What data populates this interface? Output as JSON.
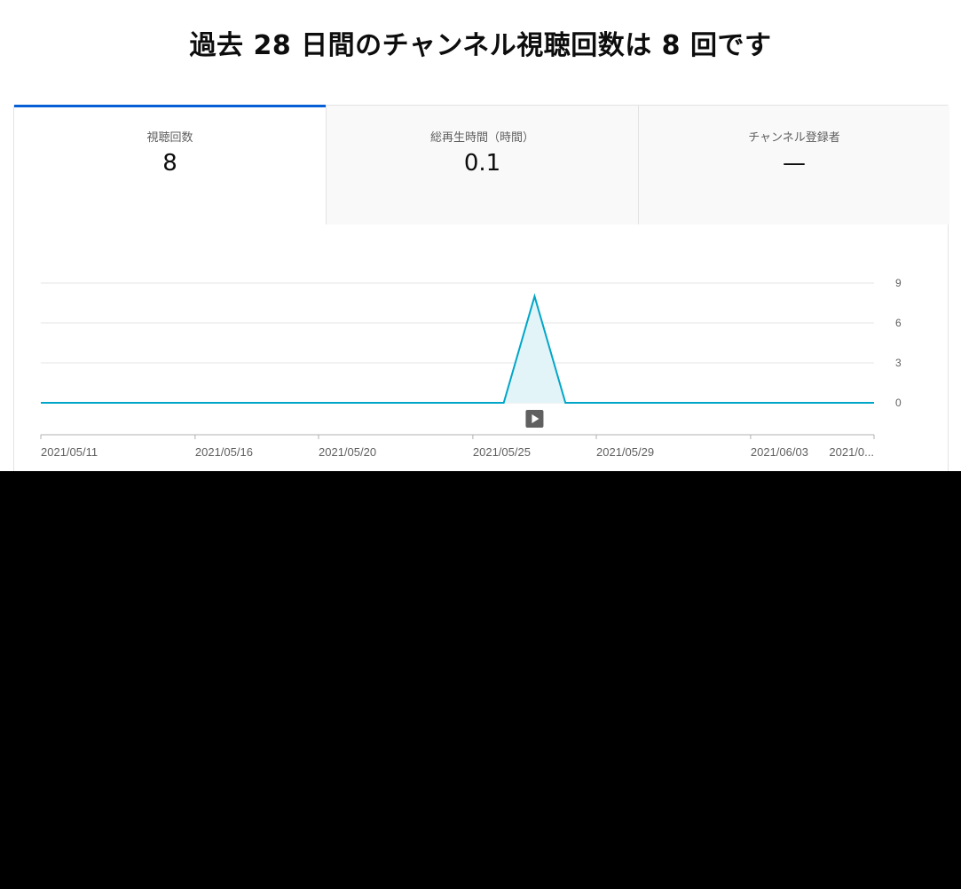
{
  "headline": "過去 28 日間のチャンネル視聴回数は 8 回です",
  "tabs": [
    {
      "label": "視聴回数",
      "value": "8",
      "active": true
    },
    {
      "label": "総再生時間（時間）",
      "value": "0.1",
      "active": false
    },
    {
      "label": "チャンネル登録者",
      "value": "—",
      "active": false
    }
  ],
  "colors": {
    "accent": "#065fd4",
    "line": "#00a6c8",
    "fill": "#e3f4f8",
    "grid": "#e6e6e6",
    "axis": "#b0b0b0",
    "marker": "#606060"
  },
  "icons": {
    "chart_marker": "play-icon"
  },
  "chart_data": {
    "type": "area",
    "metric": "視聴回数",
    "x": [
      "2021/05/11",
      "2021/05/12",
      "2021/05/13",
      "2021/05/14",
      "2021/05/15",
      "2021/05/16",
      "2021/05/17",
      "2021/05/18",
      "2021/05/19",
      "2021/05/20",
      "2021/05/21",
      "2021/05/22",
      "2021/05/23",
      "2021/05/24",
      "2021/05/25",
      "2021/05/26",
      "2021/05/27",
      "2021/05/28",
      "2021/05/29",
      "2021/05/30",
      "2021/05/31",
      "2021/06/01",
      "2021/06/02",
      "2021/06/03",
      "2021/06/04",
      "2021/06/05",
      "2021/06/06",
      "2021/06/07"
    ],
    "values": [
      0,
      0,
      0,
      0,
      0,
      0,
      0,
      0,
      0,
      0,
      0,
      0,
      0,
      0,
      0,
      0,
      8,
      0,
      0,
      0,
      0,
      0,
      0,
      0,
      0,
      0,
      0,
      0
    ],
    "x_tick_labels": [
      "2021/05/11",
      "2021/05/16",
      "2021/05/20",
      "2021/05/25",
      "2021/05/29",
      "2021/06/03",
      "2021/0..."
    ],
    "y_ticks": [
      0,
      3,
      6,
      9
    ],
    "ylim": [
      0,
      9
    ],
    "y_axis_side": "right",
    "grid": true,
    "marker_date": "2021/05/27"
  }
}
